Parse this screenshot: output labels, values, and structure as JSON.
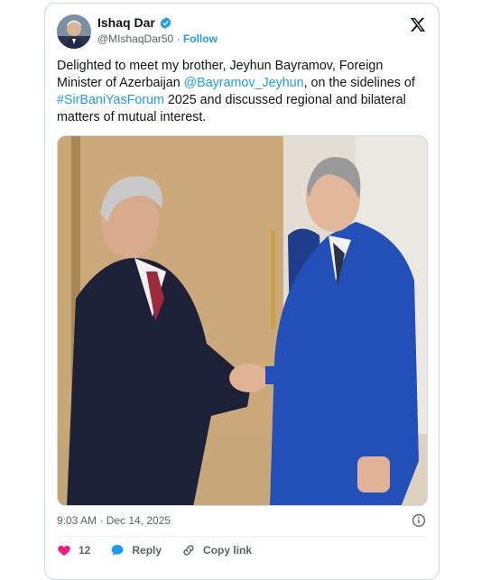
{
  "author": {
    "name": "Ishaq Dar",
    "handle": "@MIshaqDar50",
    "separator": "·",
    "follow_label": "Follow"
  },
  "tweet": {
    "text_1": "Delighted to meet my brother, Jeyhun Bayramov, Foreign Minister of Azerbaijan ",
    "mention": "@Bayramov_Jeyhun",
    "text_2": ", on the sidelines of ",
    "hashtag": "#SirBaniYasForum",
    "text_3": " 2025 and discussed regional and bilateral matters of mutual interest.",
    "timestamp": "9:03 AM · Dec 14, 2025"
  },
  "actions": {
    "like_count": "12",
    "reply_label": "Reply",
    "copy_label": "Copy link"
  },
  "colors": {
    "link": "#1d9bf0",
    "like": "#f91880",
    "reply_icon": "#1d9bf0",
    "text_secondary": "#536471"
  },
  "icons": [
    "verified-badge-icon",
    "x-logo-icon",
    "info-icon",
    "heart-icon",
    "reply-bubble-icon",
    "link-icon"
  ]
}
